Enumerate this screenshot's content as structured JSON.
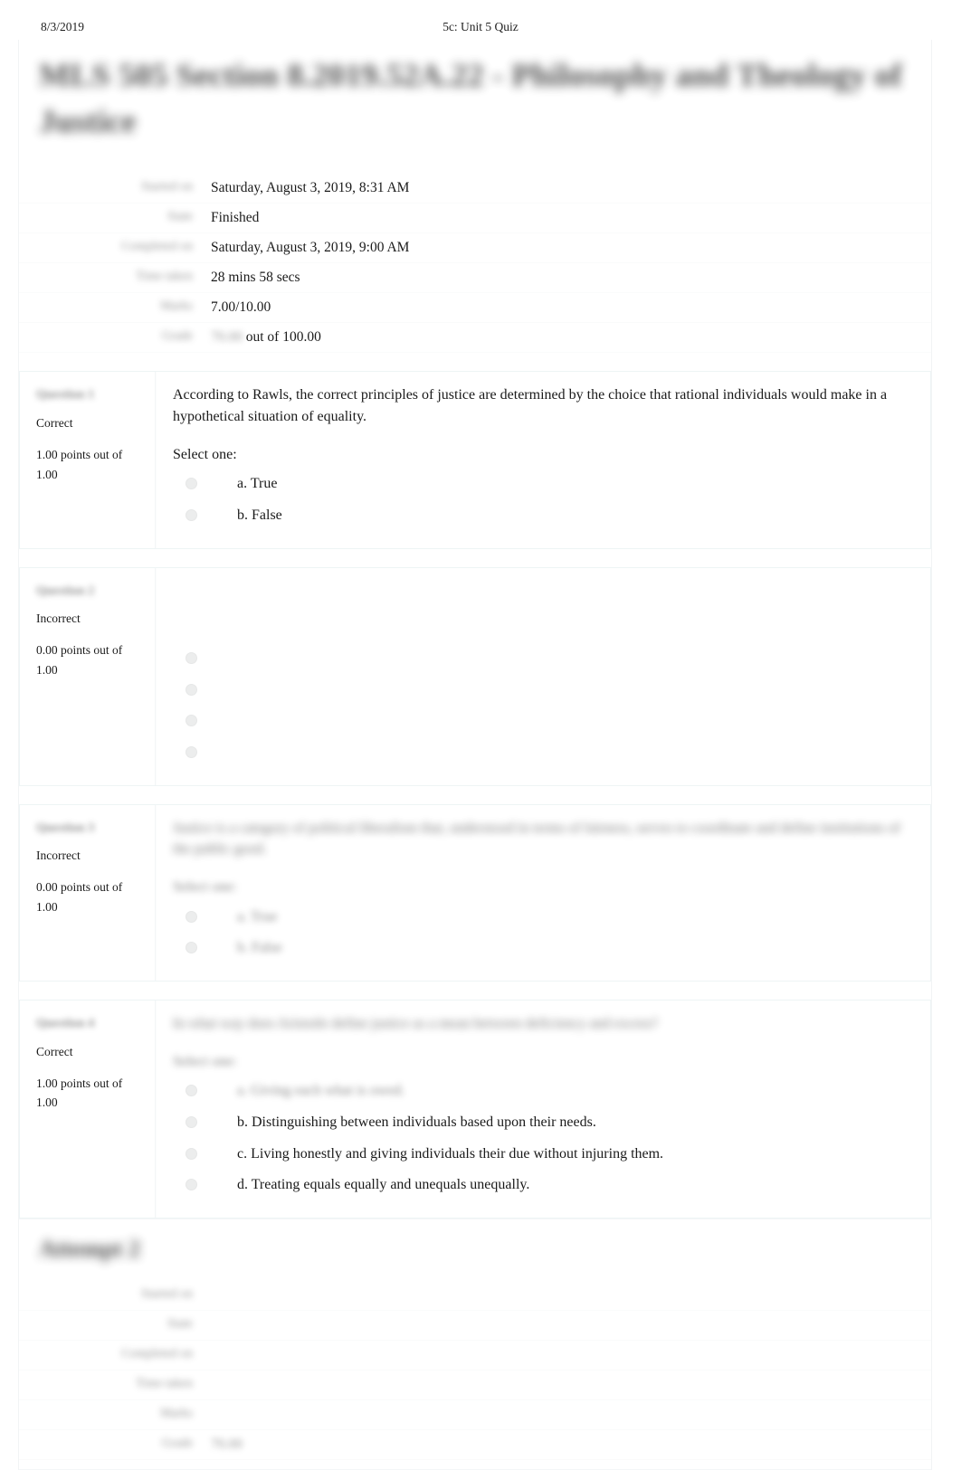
{
  "print_header": {
    "date": "8/3/2019",
    "title": "5c: Unit 5 Quiz"
  },
  "quiz": {
    "title": "MLS 505 Section 8.2019.52A.22 - Philosophy and Theology of Justice",
    "title_redacted": true
  },
  "summary": {
    "redacted_labels": true,
    "rows": [
      {
        "label": "Started on",
        "value": "Saturday, August 3, 2019, 8:31 AM",
        "value_redacted": false
      },
      {
        "label": "State",
        "value": "Finished",
        "value_redacted": false
      },
      {
        "label": "Completed on",
        "value": "Saturday, August 3, 2019, 9:00 AM",
        "value_redacted": false
      },
      {
        "label": "Time taken",
        "value": "28 mins 58 secs",
        "value_redacted": false
      },
      {
        "label": "Marks",
        "value": "7.00/10.00",
        "value_redacted": false
      },
      {
        "label": "Grade",
        "value_redacted_part": "70.00",
        "value_suffix": "out of 100.00"
      }
    ]
  },
  "questions": [
    {
      "number_label": "Question 1",
      "number_redacted": true,
      "state": "Correct",
      "marks": "1.00 points out of",
      "marks_max": "1.00",
      "text": "According to Rawls, the correct principles of justice are determined by the choice that rational individuals would make in a hypothetical situation of equality.",
      "text_redacted": false,
      "select_one": "Select one:",
      "select_one_redacted": false,
      "answers": [
        {
          "label": "a. True",
          "redacted": false
        },
        {
          "label": "b. False",
          "redacted": false
        }
      ]
    },
    {
      "number_label": "Question 2",
      "number_redacted": true,
      "state": "Incorrect",
      "marks": "0.00 points out of",
      "marks_max": "1.00",
      "text": "",
      "text_redacted": true,
      "select_one": "",
      "select_one_redacted": true,
      "answers": [
        {
          "label": "",
          "redacted": true
        },
        {
          "label": "",
          "redacted": true
        },
        {
          "label": "",
          "redacted": true
        },
        {
          "label": "",
          "redacted": true
        }
      ]
    },
    {
      "number_label": "Question 3",
      "number_redacted": true,
      "state": "Incorrect",
      "marks": "0.00 points out of",
      "marks_max": "1.00",
      "text": "Justice is a category of political liberalism that, understood in terms of fairness, serves to coordinate and define institutions of the public good.",
      "text_redacted": true,
      "select_one": "Select one:",
      "select_one_redacted": true,
      "answers": [
        {
          "label": "a. True",
          "redacted": true
        },
        {
          "label": "b. False",
          "redacted": true
        }
      ]
    },
    {
      "number_label": "Question 4",
      "number_redacted": true,
      "state": "Correct",
      "marks": "1.00 points out of",
      "marks_max": "1.00",
      "text": "In what way does Aristotle define justice as a mean between deficiency and excess?",
      "text_redacted": true,
      "select_one": "Select one:",
      "select_one_redacted": true,
      "answers": [
        {
          "label": "a. Giving each what is owed.",
          "redacted": true
        },
        {
          "label": "b. Distinguishing between individuals based upon their needs.",
          "redacted": false
        },
        {
          "label": "c. Living honestly and giving individuals their due without injuring them.",
          "redacted": false
        },
        {
          "label": "d. Treating equals equally and unequals unequally.",
          "redacted": false
        }
      ]
    }
  ],
  "bottom_section": {
    "heading": "Attempt 2",
    "heading_redacted": true,
    "summary": {
      "redacted_labels": true,
      "rows": [
        {
          "label": "Started on",
          "value": "",
          "redacted": true
        },
        {
          "label": "State",
          "value": "",
          "redacted": true
        },
        {
          "label": "Completed on",
          "value": "",
          "redacted": true
        },
        {
          "label": "Time taken",
          "value": "",
          "redacted": true
        },
        {
          "label": "Marks",
          "value": "",
          "redacted": true
        },
        {
          "label": "Grade",
          "value": "",
          "redacted": true
        }
      ]
    }
  }
}
